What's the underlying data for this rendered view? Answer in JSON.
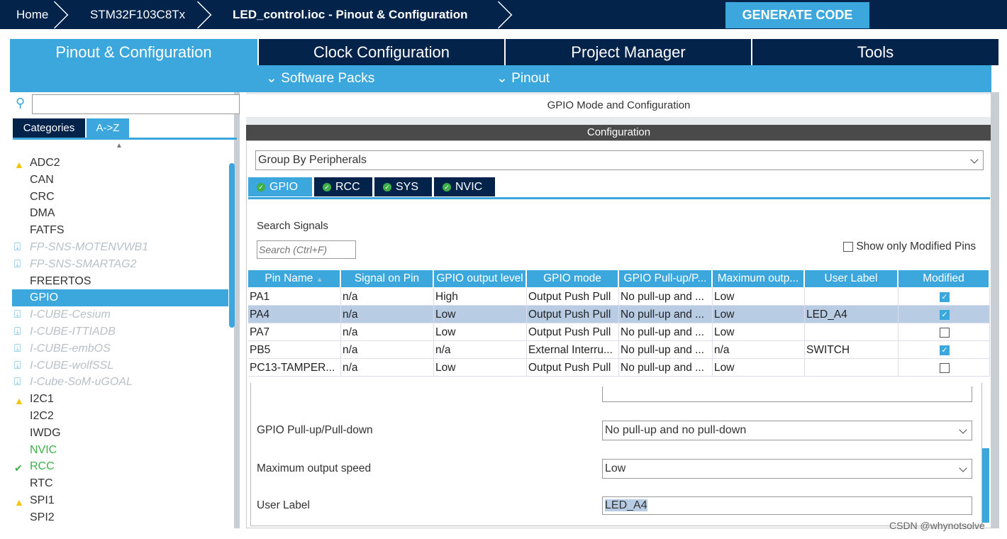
{
  "breadcrumb": {
    "home": "Home",
    "device": "STM32F103C8Tx",
    "file": "LED_control.ioc - Pinout & Configuration"
  },
  "generate_label": "GENERATE CODE",
  "main_tabs": [
    "Pinout & Configuration",
    "Clock Configuration",
    "Project Manager",
    "Tools"
  ],
  "sub_menus": [
    "Software Packs",
    "Pinout"
  ],
  "sidebar": {
    "search_value": "",
    "tabs": [
      "Categories",
      "A->Z"
    ],
    "items": [
      {
        "label": "ADC2",
        "icon": "warning"
      },
      {
        "label": "CAN"
      },
      {
        "label": "CRC"
      },
      {
        "label": "DMA"
      },
      {
        "label": "FATFS"
      },
      {
        "label": "FP-SNS-MOTENVWB1",
        "icon": "download"
      },
      {
        "label": "FP-SNS-SMARTAG2",
        "icon": "download"
      },
      {
        "label": "FREERTOS"
      },
      {
        "label": "GPIO",
        "selected": true
      },
      {
        "label": "I-CUBE-Cesium",
        "icon": "download"
      },
      {
        "label": "I-CUBE-ITTIADB",
        "icon": "download"
      },
      {
        "label": "I-CUBE-embOS",
        "icon": "download"
      },
      {
        "label": "I-CUBE-wolfSSL",
        "icon": "download"
      },
      {
        "label": "I-Cube-SoM-uGOAL",
        "icon": "download"
      },
      {
        "label": "I2C1",
        "icon": "warning"
      },
      {
        "label": "I2C2"
      },
      {
        "label": "IWDG"
      },
      {
        "label": "NVIC",
        "state": "green"
      },
      {
        "label": "RCC",
        "icon": "check",
        "state": "green"
      },
      {
        "label": "RTC"
      },
      {
        "label": "SPI1",
        "icon": "warning"
      },
      {
        "label": "SPI2"
      }
    ]
  },
  "panel": {
    "title": "GPIO Mode and Configuration",
    "config_title": "Configuration",
    "group_by": "Group By Peripherals",
    "tabs": [
      "GPIO",
      "RCC",
      "SYS",
      "NVIC"
    ],
    "search_label": "Search Signals",
    "search_placeholder": "Search (Ctrl+F)",
    "show_modified_label": "Show only Modified Pins",
    "show_modified_checked": false,
    "columns": [
      "Pin Name",
      "Signal on Pin",
      "GPIO output level",
      "GPIO mode",
      "GPIO Pull-up/P...",
      "Maximum outp...",
      "User Label",
      "Modified"
    ],
    "rows": [
      [
        "PA1",
        "n/a",
        "High",
        "Output Push Pull",
        "No pull-up and ...",
        "Low",
        "",
        true
      ],
      [
        "PA4",
        "n/a",
        "Low",
        "Output Push Pull",
        "No pull-up and ...",
        "Low",
        "LED_A4",
        true
      ],
      [
        "PA7",
        "n/a",
        "Low",
        "Output Push Pull",
        "No pull-up and ...",
        "Low",
        "",
        false
      ],
      [
        "PB5",
        "n/a",
        "n/a",
        "External Interru...",
        "No pull-up and ...",
        "n/a",
        "SWITCH",
        true
      ],
      [
        "PC13-TAMPER...",
        "n/a",
        "Low",
        "Output Push Pull",
        "No pull-up and ...",
        "Low",
        "",
        false
      ]
    ],
    "selected_row": 1,
    "detail": {
      "pull_label": "GPIO Pull-up/Pull-down",
      "pull_value": "No pull-up and no pull-down",
      "speed_label": "Maximum output speed",
      "speed_value": "Low",
      "user_label_label": "User Label",
      "user_label_value": "LED_A4"
    }
  },
  "watermark": "CSDN @whynotsolve",
  "colors": {
    "navy": "#03234b",
    "accent": "#3ca7dd",
    "ok": "#3db04a",
    "warn": "#f5c400"
  }
}
